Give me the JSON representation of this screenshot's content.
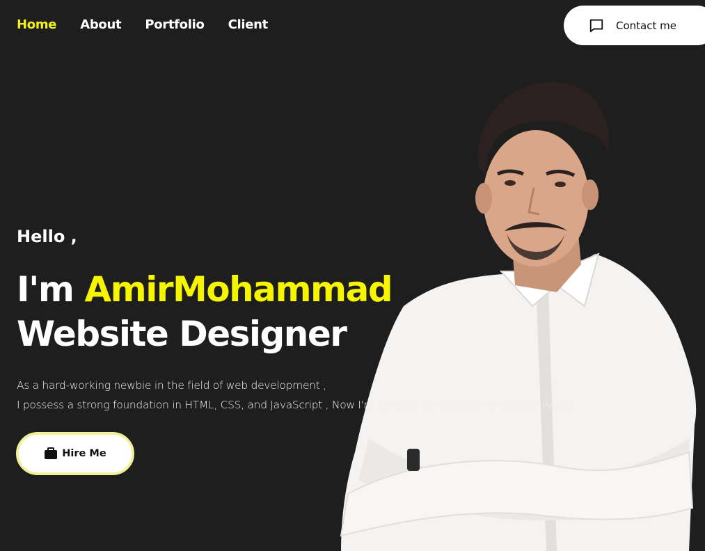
{
  "nav": {
    "items": [
      {
        "label": "Home",
        "active": true
      },
      {
        "label": "About",
        "active": false
      },
      {
        "label": "Portfolio",
        "active": false
      },
      {
        "label": "Client",
        "active": false
      }
    ],
    "contact_label": "Contact me",
    "contact_icon": "message-square-icon"
  },
  "hero": {
    "greeting": "Hello ,",
    "headline_prefix": "I'm ",
    "name": "AmirMohammad",
    "role": "Website Designer",
    "description_line1": "As a hard-working newbie in the field of web development ,",
    "description_line2": "I possess a strong foundation in HTML, CSS, and JavaScript , Now I'm on track to develop my skills in React",
    "hire_label": "Hire Me",
    "hire_icon": "briefcase-icon"
  },
  "colors": {
    "background": "#1e1e1e",
    "accent": "#f5f500",
    "hire_border": "#f3f09a",
    "text": "#ffffff"
  }
}
